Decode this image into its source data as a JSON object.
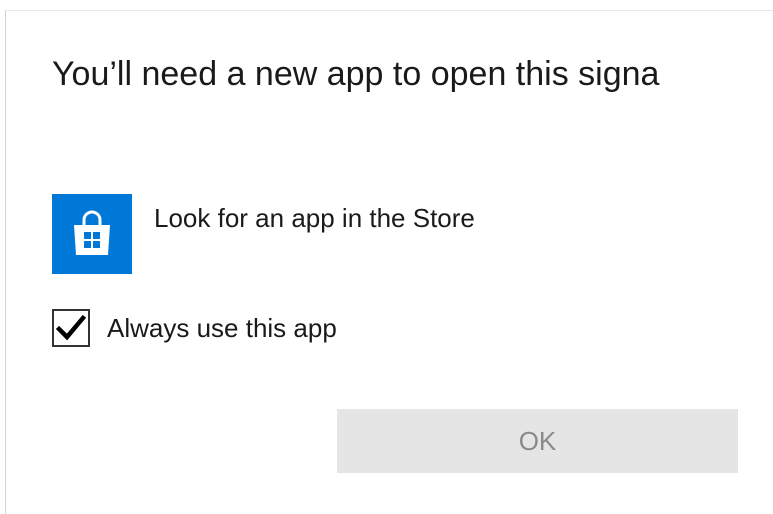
{
  "dialog": {
    "title": "You’ll need a new app to open this signa",
    "store_option": {
      "label": "Look for an app in the Store",
      "icon": "store-bag-icon",
      "tile_color": "#0078d7"
    },
    "always_use": {
      "label": "Always use this app",
      "checked": true
    },
    "ok_button": {
      "label": "OK",
      "enabled": false
    }
  }
}
